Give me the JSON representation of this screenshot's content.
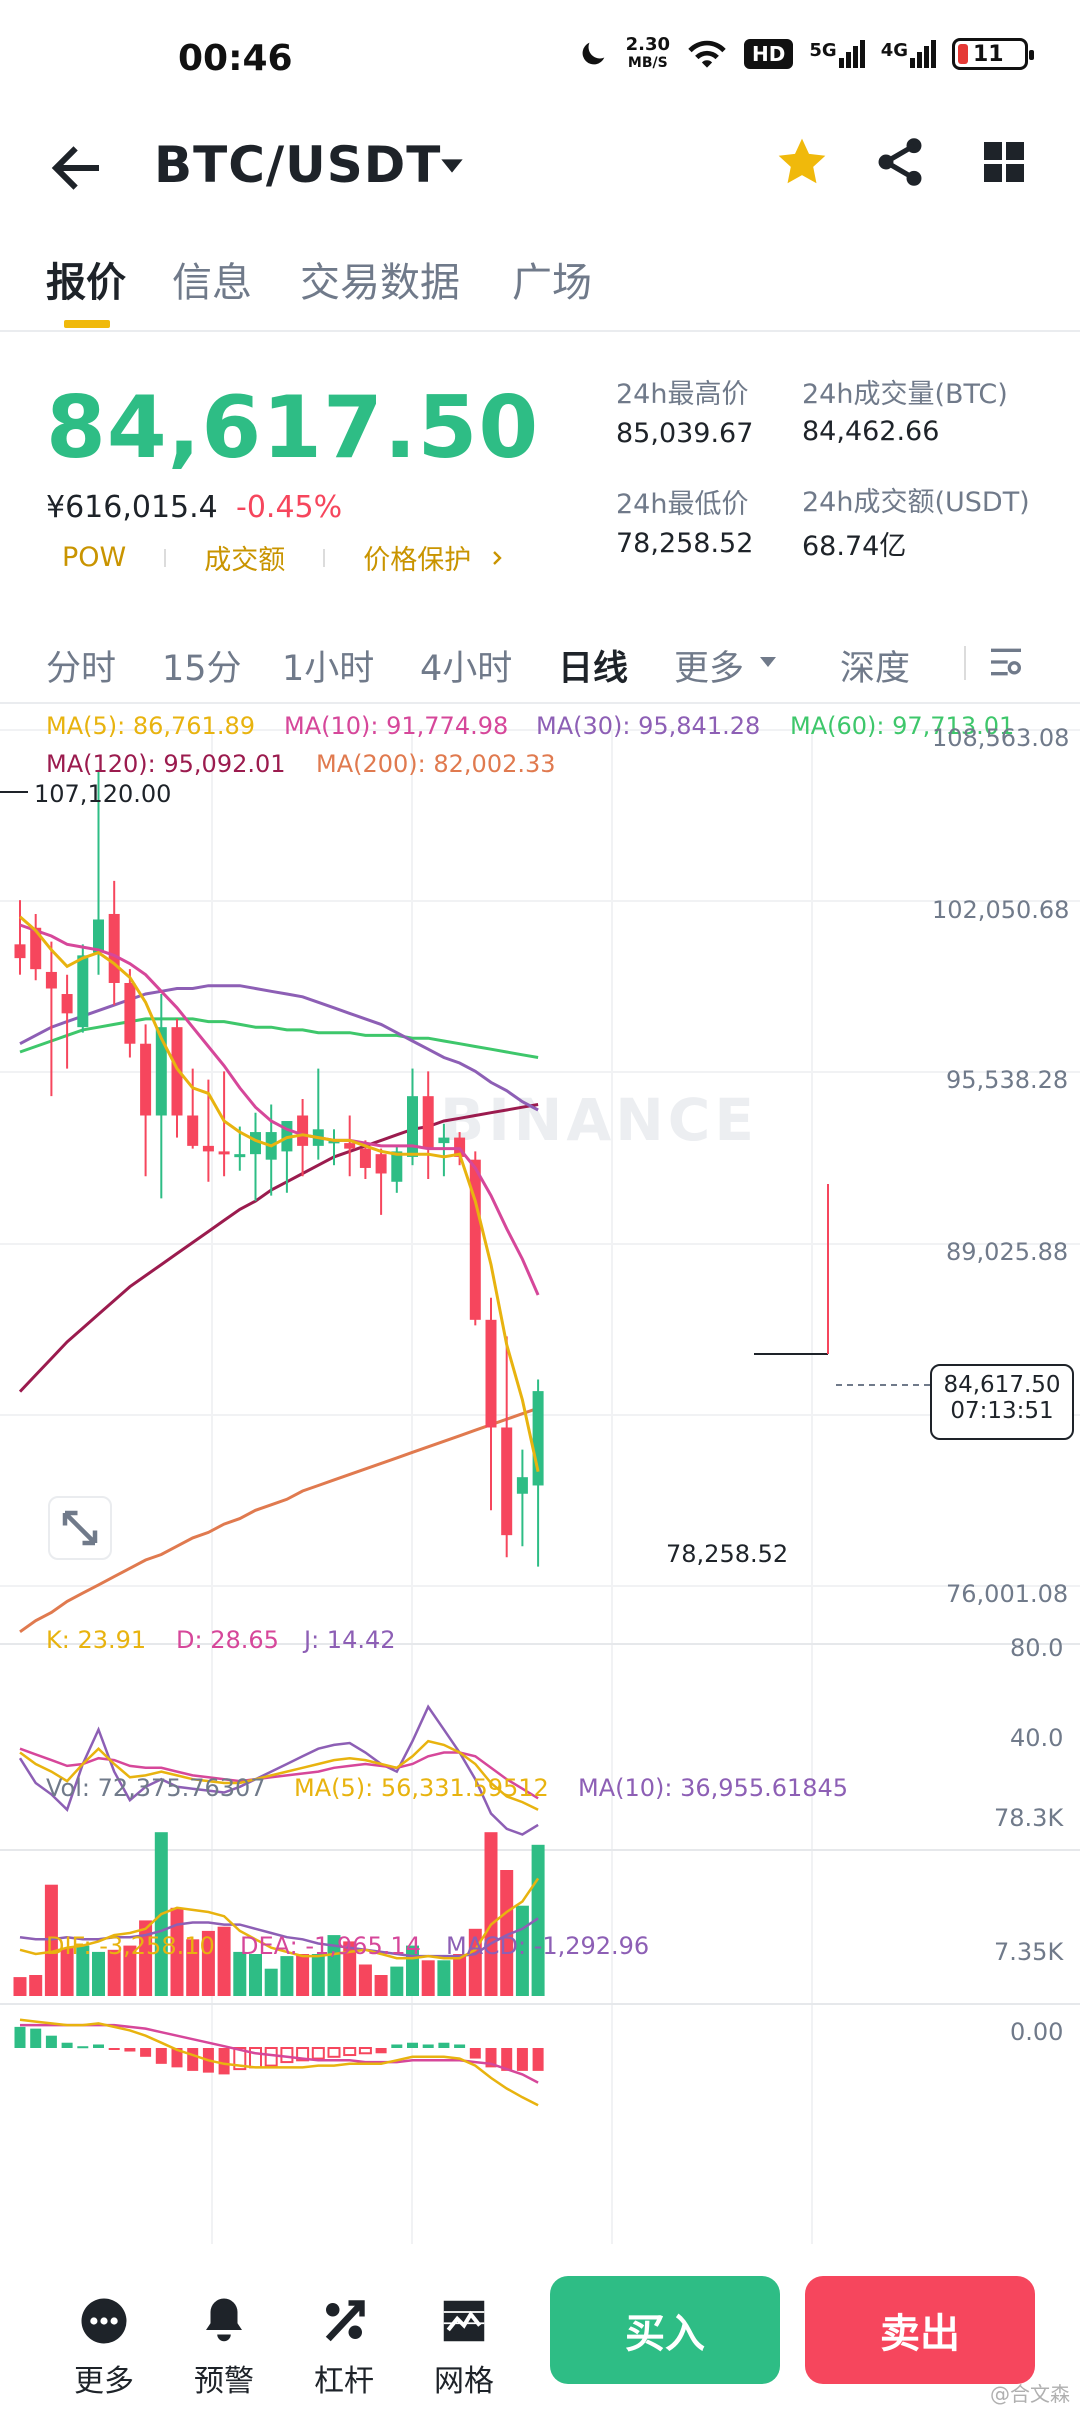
{
  "status_bar": {
    "time": "00:46",
    "net_speed_value": "2.30",
    "net_speed_unit": "MB/S",
    "hd_badge": "HD",
    "sim1": "5G",
    "sim2": "4G",
    "battery": "11"
  },
  "header": {
    "pair": "BTC/USDT"
  },
  "tabs": [
    {
      "label": "报价"
    },
    {
      "label": "信息"
    },
    {
      "label": "交易数据"
    },
    {
      "label": "广场"
    }
  ],
  "price": {
    "last": "84,617.50",
    "cny": "¥616,015.4",
    "change": "-0.45%",
    "tags": [
      "POW",
      "成交额",
      "价格保护"
    ]
  },
  "stats": {
    "high_label": "24h最高价",
    "high_value": "85,039.67",
    "low_label": "24h最低价",
    "low_value": "78,258.52",
    "vol_btc_label": "24h成交量(BTC)",
    "vol_btc_value": "84,462.66",
    "vol_usdt_label": "24h成交额(USDT)",
    "vol_usdt_value": "68.74亿"
  },
  "intervals": [
    {
      "label": "分时"
    },
    {
      "label": "15分"
    },
    {
      "label": "1小时"
    },
    {
      "label": "4小时"
    },
    {
      "label": "日线"
    },
    {
      "label": "更多"
    },
    {
      "label": "深度"
    }
  ],
  "ma_legend": {
    "ma5": "MA(5): 86,761.89",
    "ma10": "MA(10): 91,774.98",
    "ma30": "MA(30): 95,841.28",
    "ma60": "MA(60): 97,713.01",
    "ma120": "MA(120): 95,092.01",
    "ma200": "MA(200): 82,002.33"
  },
  "price_axis": [
    "108,563.08",
    "102,050.68",
    "95,538.28",
    "89,025.88",
    "76,001.08"
  ],
  "chart_annotations": {
    "high_marker": "107,120.00",
    "low_marker": "78,258.52",
    "current_price": "84,617.50",
    "countdown": "07:13:51",
    "watermark": "BINANCE"
  },
  "kdj": {
    "k": "K: 23.91",
    "d": "D: 28.65",
    "j": "J: 14.42",
    "axis_top": "80.0",
    "axis_mid": "40.0"
  },
  "volume": {
    "vol": "Vol: 72,375.76307",
    "ma5": "MA(5): 56,331.59512",
    "ma10": "MA(10): 36,955.61845",
    "axis_top": "78.3K",
    "axis_bottom": "7.35K"
  },
  "macd": {
    "dif": "DIF: -3,258.10",
    "dea": "DEA: -1,965.14",
    "macd": "MACD: -1,292.96",
    "axis_zero": "0.00"
  },
  "bottom_nav": [
    {
      "label": "更多",
      "icon": "more-icon"
    },
    {
      "label": "预警",
      "icon": "bell-icon"
    },
    {
      "label": "杠杆",
      "icon": "leverage-icon"
    },
    {
      "label": "网格",
      "icon": "grid-trading-icon"
    }
  ],
  "buy_label": "买入",
  "sell_label": "卖出",
  "corner_watermark": "@合文森",
  "colors": {
    "up": "#2ebd85",
    "down": "#f6465d",
    "accent": "#f0b90b",
    "ma5": "#e8b30f",
    "ma10": "#d6479a",
    "ma30": "#8d5fb5",
    "ma60": "#3ec76b",
    "ma120": "#9b1b4e",
    "ma200": "#e07a4f"
  },
  "chart_data": {
    "type": "candlestick",
    "ylim": [
      76001.08,
      108563.08
    ],
    "candles": [
      {
        "o": 100800,
        "h": 102400,
        "l": 99700,
        "c": 100300
      },
      {
        "o": 101400,
        "h": 101900,
        "l": 99500,
        "c": 99900
      },
      {
        "o": 99800,
        "h": 100900,
        "l": 95300,
        "c": 99200
      },
      {
        "o": 99000,
        "h": 99700,
        "l": 96300,
        "c": 98300
      },
      {
        "o": 97800,
        "h": 100800,
        "l": 97600,
        "c": 100400
      },
      {
        "o": 100500,
        "h": 107120,
        "l": 99700,
        "c": 101700
      },
      {
        "o": 101900,
        "h": 103100,
        "l": 98600,
        "c": 99400
      },
      {
        "o": 99400,
        "h": 99900,
        "l": 96700,
        "c": 97200
      },
      {
        "o": 97200,
        "h": 97900,
        "l": 92400,
        "c": 94600
      },
      {
        "o": 94600,
        "h": 99000,
        "l": 91600,
        "c": 97800
      },
      {
        "o": 97800,
        "h": 98100,
        "l": 93800,
        "c": 94600
      },
      {
        "o": 94600,
        "h": 96300,
        "l": 93400,
        "c": 93500
      },
      {
        "o": 93500,
        "h": 95900,
        "l": 92200,
        "c": 93300
      },
      {
        "o": 93300,
        "h": 96200,
        "l": 92400,
        "c": 93200
      },
      {
        "o": 93200,
        "h": 94200,
        "l": 92600,
        "c": 93200
      },
      {
        "o": 93200,
        "h": 94700,
        "l": 91500,
        "c": 94000
      },
      {
        "o": 93000,
        "h": 95000,
        "l": 91700,
        "c": 94000
      },
      {
        "o": 93300,
        "h": 94300,
        "l": 91800,
        "c": 94400
      },
      {
        "o": 94600,
        "h": 95200,
        "l": 92400,
        "c": 93500
      },
      {
        "o": 93500,
        "h": 96300,
        "l": 93000,
        "c": 94100
      },
      {
        "o": 93600,
        "h": 94100,
        "l": 92800,
        "c": 93700
      },
      {
        "o": 93600,
        "h": 94600,
        "l": 92400,
        "c": 93400
      },
      {
        "o": 93400,
        "h": 93700,
        "l": 92300,
        "c": 92700
      },
      {
        "o": 93200,
        "h": 93400,
        "l": 91000,
        "c": 92500
      },
      {
        "o": 92200,
        "h": 93500,
        "l": 91800,
        "c": 93300
      },
      {
        "o": 93100,
        "h": 96300,
        "l": 92800,
        "c": 95300
      },
      {
        "o": 95300,
        "h": 96200,
        "l": 92300,
        "c": 93400
      },
      {
        "o": 93600,
        "h": 94300,
        "l": 92400,
        "c": 93800
      },
      {
        "o": 93800,
        "h": 94000,
        "l": 92800,
        "c": 93100
      },
      {
        "o": 93000,
        "h": 93300,
        "l": 87000,
        "c": 87200
      },
      {
        "o": 87200,
        "h": 88000,
        "l": 80300,
        "c": 83300
      },
      {
        "o": 83300,
        "h": 86600,
        "l": 78600,
        "c": 79400
      },
      {
        "o": 80900,
        "h": 82500,
        "l": 79000,
        "c": 81500
      },
      {
        "o": 81200,
        "h": 85039.67,
        "l": 78258.52,
        "c": 84617.5
      }
    ],
    "ma5": [
      101800,
      101300,
      100600,
      100000,
      100300,
      100500,
      100100,
      99600,
      98700,
      97400,
      96300,
      95600,
      95400,
      94400,
      94000,
      93700,
      93500,
      93800,
      93900,
      93800,
      93700,
      93700,
      93500,
      93300,
      93200,
      93200,
      93200,
      93100,
      93200,
      91500,
      89200,
      86300,
      84300,
      81700
    ],
    "ma10": [
      101500,
      101300,
      101100,
      100800,
      100700,
      100600,
      100400,
      100100,
      99700,
      99100,
      98500,
      97800,
      97100,
      96400,
      95600,
      94900,
      94400,
      94100,
      93900,
      93800,
      93700,
      93700,
      93600,
      93500,
      93500,
      93500,
      93400,
      93400,
      93400,
      92700,
      91700,
      90500,
      89400,
      88100
    ],
    "ma30": [
      97200,
      97500,
      97800,
      98000,
      98200,
      98400,
      98600,
      98800,
      99000,
      99100,
      99200,
      99200,
      99300,
      99300,
      99300,
      99200,
      99100,
      99000,
      98900,
      98700,
      98500,
      98300,
      98100,
      97900,
      97600,
      97300,
      97000,
      96700,
      96500,
      96200,
      95800,
      95500,
      95100,
      94800
    ],
    "ma60": [
      96900,
      97100,
      97300,
      97500,
      97700,
      97800,
      97900,
      98000,
      98100,
      98100,
      98100,
      98100,
      98000,
      98000,
      97900,
      97800,
      97800,
      97700,
      97700,
      97600,
      97600,
      97600,
      97500,
      97500,
      97500,
      97400,
      97400,
      97300,
      97200,
      97100,
      97000,
      96900,
      96800,
      96700
    ],
    "ma120": [
      84600,
      85200,
      85800,
      86400,
      86900,
      87400,
      87900,
      88400,
      88800,
      89200,
      89600,
      90000,
      90400,
      90800,
      91200,
      91500,
      91900,
      92200,
      92500,
      92800,
      93100,
      93300,
      93500,
      93700,
      93900,
      94100,
      94200,
      94400,
      94500,
      94600,
      94700,
      94800,
      94900,
      95000
    ],
    "ma200": [
      75900,
      76300,
      76600,
      77000,
      77300,
      77600,
      77900,
      78200,
      78500,
      78700,
      79000,
      79300,
      79500,
      79800,
      80000,
      80300,
      80500,
      80700,
      81000,
      81200,
      81400,
      81600,
      81800,
      82000,
      82200,
      82400,
      82600,
      82800,
      83000,
      83200,
      83400,
      83600,
      83800,
      84000
    ],
    "kdj_ylim": [
      10,
      95
    ],
    "k": [
      58,
      52,
      48,
      43,
      52,
      60,
      52,
      45,
      46,
      48,
      46,
      44,
      43,
      42,
      42,
      44,
      46,
      48,
      50,
      52,
      54,
      55,
      54,
      52,
      50,
      56,
      64,
      62,
      58,
      52,
      42,
      35,
      32,
      28
    ],
    "d": [
      60,
      57,
      54,
      51,
      52,
      55,
      54,
      51,
      50,
      50,
      48,
      46,
      45,
      44,
      43,
      44,
      45,
      46,
      47,
      48,
      50,
      51,
      52,
      51,
      50,
      52,
      56,
      58,
      58,
      56,
      50,
      44,
      39,
      34
    ],
    "j": [
      55,
      42,
      36,
      28,
      52,
      70,
      48,
      33,
      40,
      44,
      40,
      39,
      38,
      37,
      40,
      44,
      48,
      52,
      56,
      60,
      62,
      63,
      58,
      52,
      48,
      64,
      82,
      70,
      58,
      44,
      26,
      18,
      15,
      20
    ],
    "vol_ylim": [
      0,
      80000
    ],
    "volume": [
      9000,
      10000,
      53000,
      23000,
      24000,
      21000,
      22000,
      24000,
      36000,
      78000,
      42000,
      27000,
      31000,
      33000,
      21000,
      20000,
      13000,
      19000,
      20000,
      20000,
      29000,
      26000,
      15000,
      10000,
      14000,
      24000,
      17000,
      17000,
      20000,
      32000,
      78000,
      60000,
      43000,
      72000
    ],
    "vol_ma5": [
      22000,
      20000,
      21000,
      23000,
      24000,
      26000,
      29000,
      30000,
      32000,
      39000,
      42000,
      41000,
      40000,
      38000,
      31000,
      27000,
      23000,
      21000,
      19000,
      19000,
      20000,
      21000,
      22000,
      20000,
      18000,
      18000,
      19000,
      18000,
      18000,
      22000,
      34000,
      40000,
      45000,
      56000
    ],
    "vol_ma10": [
      28000,
      27000,
      27000,
      28000,
      27000,
      27000,
      28000,
      28000,
      29000,
      31000,
      34000,
      35000,
      35000,
      34000,
      34000,
      32000,
      30000,
      28000,
      27000,
      25000,
      24000,
      23000,
      22000,
      21000,
      20000,
      19000,
      19000,
      19000,
      19000,
      20000,
      25000,
      29000,
      32000,
      37000
    ],
    "macd_ylim": [
      -5000,
      2500
    ],
    "hist": [
      1200,
      1100,
      700,
      300,
      100,
      200,
      -100,
      -200,
      -500,
      -900,
      -1100,
      -1300,
      -1400,
      -1500,
      -1200,
      -1100,
      -1000,
      -800,
      -700,
      -600,
      -500,
      -400,
      -300,
      -300,
      200,
      300,
      200,
      300,
      200,
      -600,
      -1100,
      -1300,
      -1300,
      -1300
    ],
    "dif": [
      1600,
      1500,
      1400,
      1300,
      1300,
      1400,
      1200,
      1000,
      700,
      300,
      -100,
      -400,
      -700,
      -900,
      -1000,
      -1100,
      -1100,
      -1100,
      -1100,
      -1000,
      -1000,
      -900,
      -900,
      -900,
      -700,
      -500,
      -500,
      -500,
      -600,
      -1000,
      -1700,
      -2300,
      -2800,
      -3258
    ],
    "dea": [
      1300,
      1300,
      1300,
      1300,
      1300,
      1300,
      1300,
      1200,
      1100,
      900,
      700,
      500,
      300,
      100,
      -100,
      -300,
      -400,
      -500,
      -600,
      -700,
      -700,
      -700,
      -800,
      -800,
      -800,
      -700,
      -700,
      -700,
      -700,
      -800,
      -900,
      -1200,
      -1500,
      -1965
    ]
  }
}
